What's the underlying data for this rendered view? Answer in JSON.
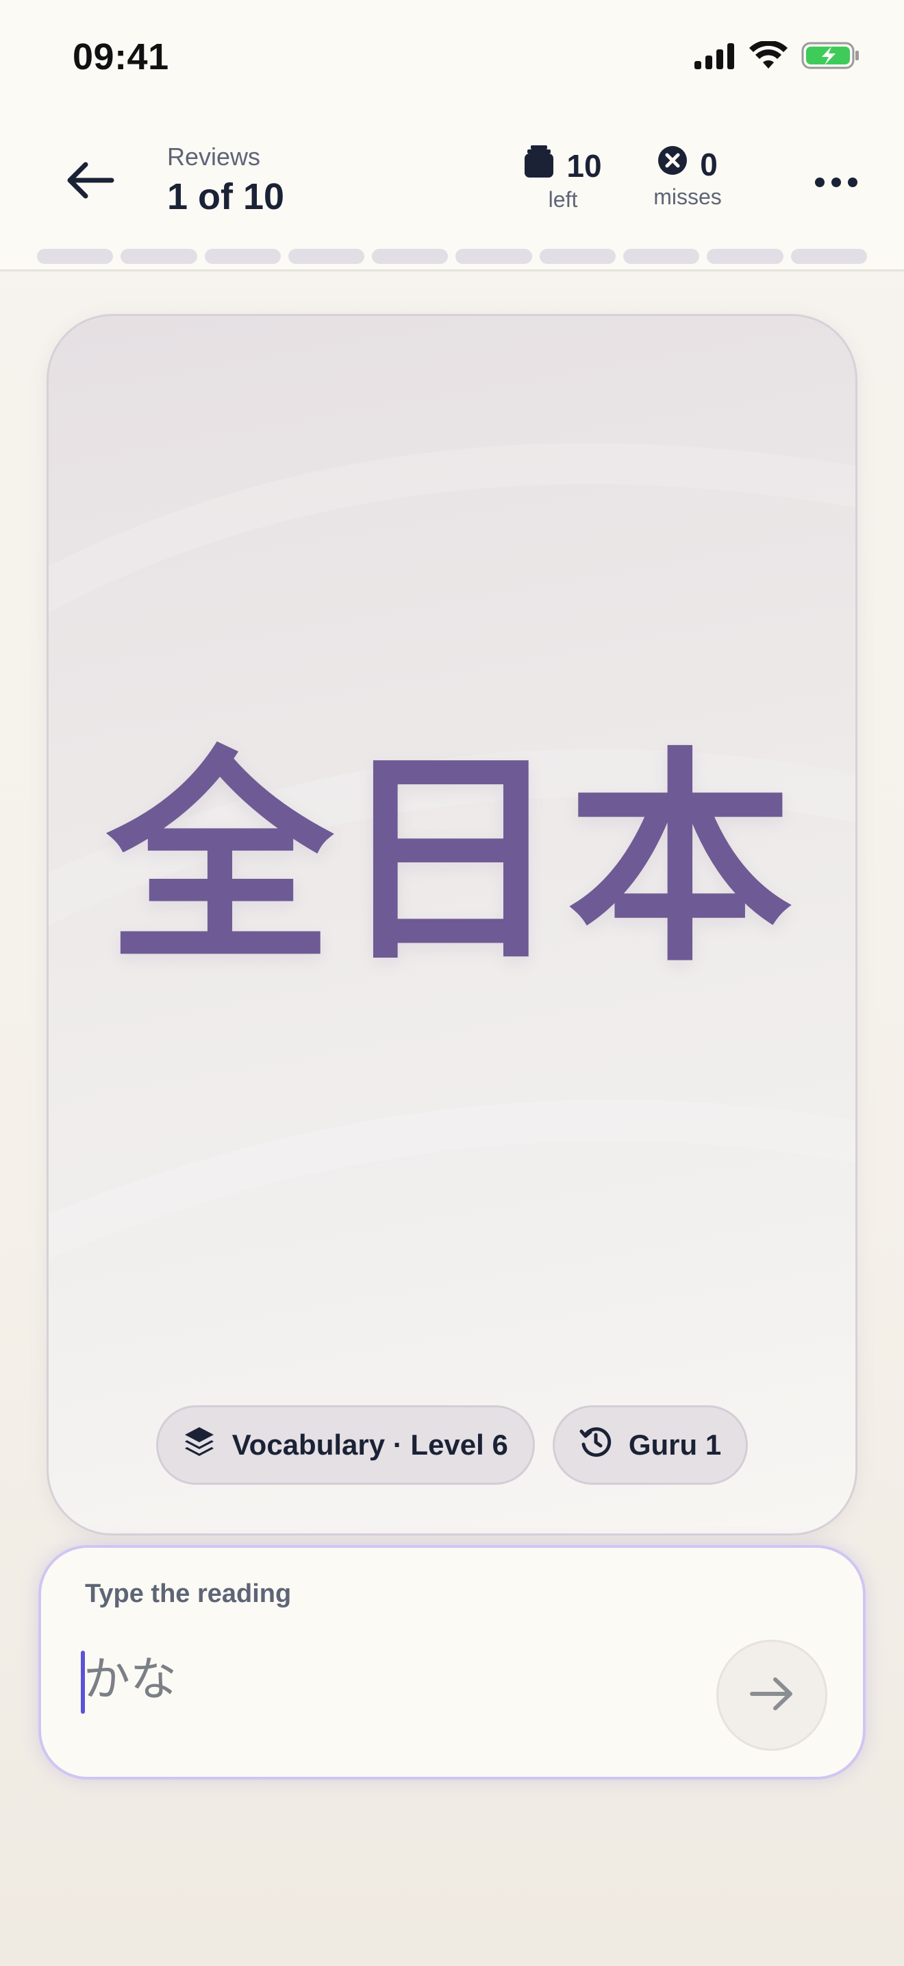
{
  "status_bar": {
    "time": "09:41",
    "icons": [
      "signal-icon",
      "wifi-icon",
      "battery-charging-icon"
    ]
  },
  "header": {
    "eyebrow": "Reviews",
    "title": "1 of 10",
    "stats": [
      {
        "icon": "card-stack-icon",
        "value": "10",
        "label": "left"
      },
      {
        "icon": "x-circle-icon",
        "value": "0",
        "label": "misses"
      }
    ],
    "progress": {
      "completed": 0,
      "total": 10
    }
  },
  "subject": {
    "characters": "全日本",
    "color": "#6e5a94",
    "chips": [
      {
        "icon": "layers-icon",
        "label": "Vocabulary · Level 6"
      },
      {
        "icon": "history-icon",
        "label": "Guru 1"
      }
    ]
  },
  "answer": {
    "prompt": "Type the reading",
    "placeholder": "かな",
    "value": "",
    "accent": "#5b53d6"
  }
}
